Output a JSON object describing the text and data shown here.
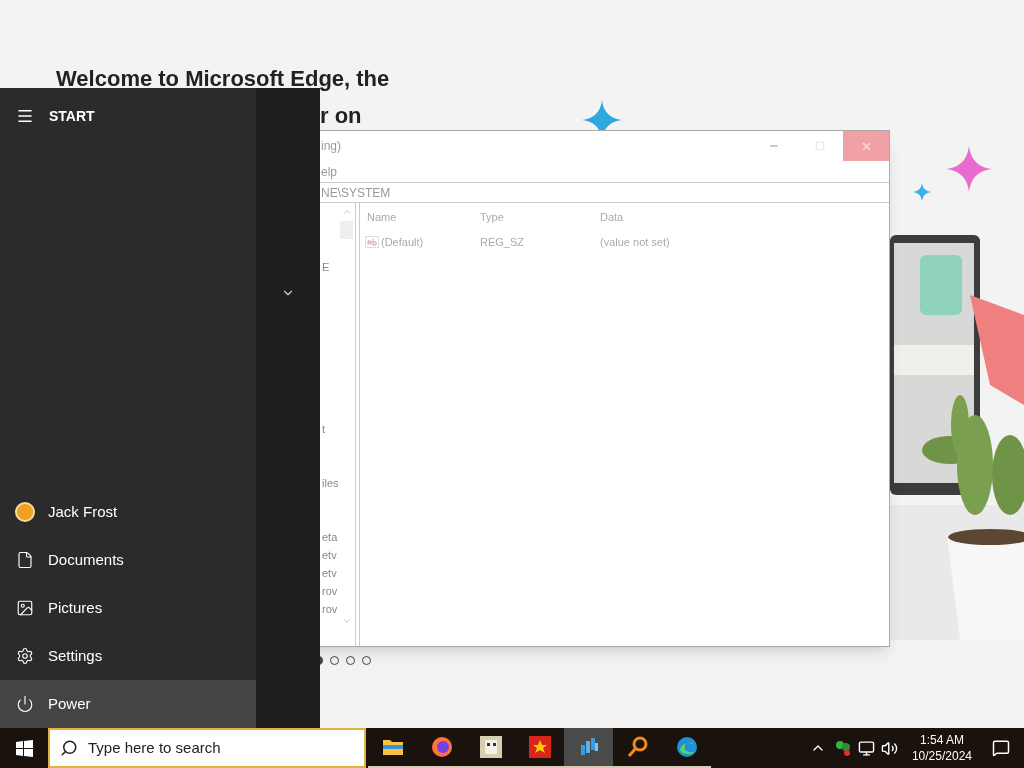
{
  "page": {
    "heading_lines": [
      "Welcome to Microsoft Edge, the",
      "r on"
    ],
    "carousel": [
      {
        "selected": true
      },
      {
        "selected": false
      },
      {
        "selected": false
      },
      {
        "selected": false
      }
    ]
  },
  "registry_window": {
    "title": "ing)",
    "menu": [
      "elp"
    ],
    "address": "NE\\SYSTEM",
    "tree_items": [
      "E",
      "t",
      "iles",
      "eta",
      "etv",
      "etv",
      "rov",
      "rov"
    ],
    "columns": [
      "Name",
      "Type",
      "Data"
    ],
    "rows": [
      {
        "name": "(Default)",
        "type": "REG_SZ",
        "data": "(value not set)"
      }
    ]
  },
  "start_menu": {
    "title": "START",
    "items": [
      {
        "kind": "user",
        "label": "Jack Frost",
        "selected": false
      },
      {
        "kind": "documents",
        "label": "Documents",
        "selected": false
      },
      {
        "kind": "pictures",
        "label": "Pictures",
        "selected": false
      },
      {
        "kind": "settings",
        "label": "Settings",
        "selected": false
      },
      {
        "kind": "power",
        "label": "Power",
        "selected": true
      }
    ]
  },
  "taskbar": {
    "search": {
      "placeholder": "Type here to search"
    },
    "apps": [
      {
        "kind": "folder",
        "selected": false
      },
      {
        "kind": "firefox",
        "selected": false
      },
      {
        "kind": "game",
        "selected": false
      },
      {
        "kind": "flag",
        "selected": false
      },
      {
        "kind": "cubes",
        "selected": true
      },
      {
        "kind": "magnifier",
        "selected": false
      },
      {
        "kind": "edge",
        "selected": false
      }
    ],
    "time": "1:54 AM",
    "date": "10/25/2024"
  }
}
